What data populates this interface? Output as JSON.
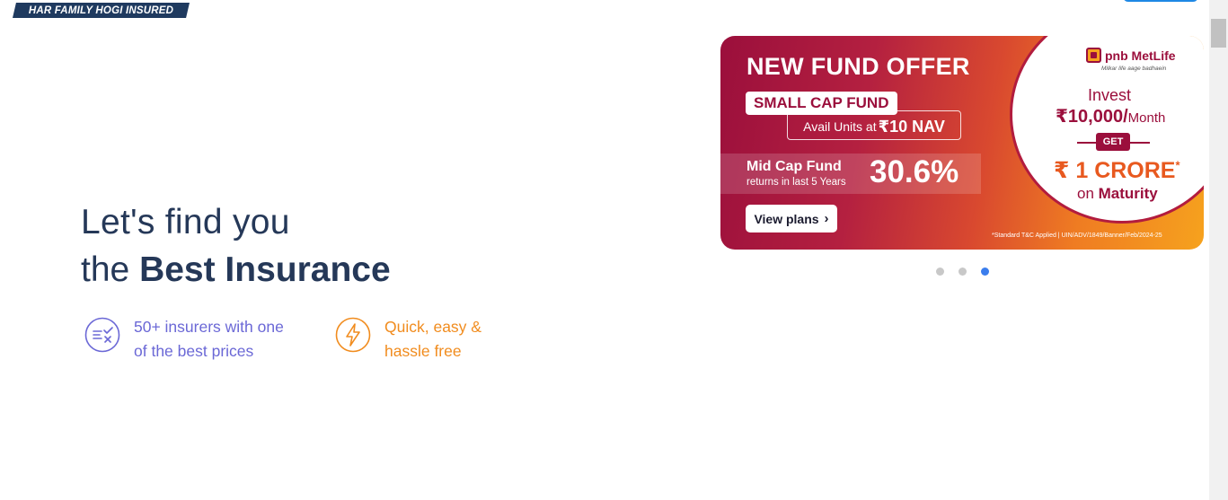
{
  "header": {
    "tagline": "HAR FAMILY HOGI INSURED"
  },
  "hero": {
    "line1": "Let's find you",
    "line2_prefix": "the ",
    "line2_bold": "Best Insurance"
  },
  "features": [
    {
      "icon": "compare-list-icon",
      "line1": "50+ insurers with one",
      "line2": "of the best prices",
      "color": "#6b68d6"
    },
    {
      "icon": "lightning-icon",
      "line1": "Quick, easy &",
      "line2": "hassle free",
      "color": "#f18c1e"
    }
  ],
  "banner": {
    "title": "NEW FUND OFFER",
    "fund_tag": "SMALL CAP FUND",
    "nav_prefix": "Avail Units at ",
    "nav_value": "₹10 NAV",
    "mid_title": "Mid Cap Fund",
    "mid_sub": "returns in last 5 Years",
    "mid_pct": "30.6%",
    "cta": "View plans",
    "disclaimer": "*Standard T&C Applied | UIN/ADV/1849/Banner/Feb/2024-25",
    "brand": "pnb MetLife",
    "brand_tagline": "Milkar life aage badhaein",
    "invest": "Invest",
    "amount": "₹10,000/",
    "amount_unit": "Month",
    "get": "GET",
    "crore": "₹ 1 CRORE",
    "crore_mark": "*",
    "maturity_prefix": "on ",
    "maturity": "Maturity",
    "colors": {
      "primary": "#9b0f3c",
      "accent": "#f6a21e"
    }
  },
  "carousel": {
    "total": 3,
    "active_index": 2,
    "active_color": "#3b7ded"
  }
}
